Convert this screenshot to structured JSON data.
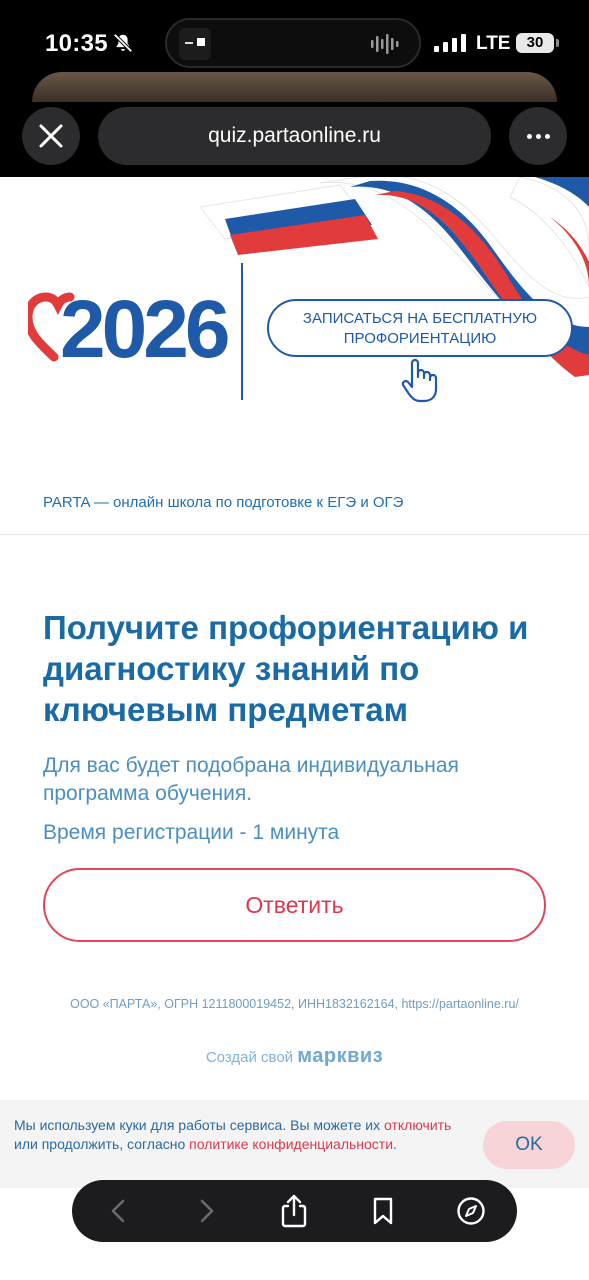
{
  "status_bar": {
    "time": "10:35",
    "network": "LTE",
    "battery": "30",
    "icons": [
      "bell-slash-icon",
      "signal-bars-icon",
      "audio-wave-icon"
    ]
  },
  "browser": {
    "url": "quiz.partaonline.ru",
    "close_icon": "close-icon",
    "more_icon": "ellipsis-icon"
  },
  "banner": {
    "year": "2026",
    "cta_line1": "ЗАПИСАТЬСЯ НА БЕСПЛАТНУЮ",
    "cta_line2": "ПРОФОРИЕНТАЦИЮ",
    "colors": {
      "blue": "#1e5aa8",
      "red": "#e23b3b",
      "white": "#ffffff"
    }
  },
  "school_line": "PARTA — онлайн школа по подготовке к ЕГЭ и ОГЭ",
  "main": {
    "headline": "Получите профориентацию и диагностику знаний по ключевым предметам",
    "sub1": "Для вас будет подобрана индивидуальная программа обучения.",
    "sub2": "Время регистрации - 1 минута",
    "answer_button": "Ответить"
  },
  "legal": "ООО «ПАРТА», ОГРН 1211800019452, ИНН1832162164, https://partaonline.ru/",
  "made_with": {
    "prefix": "Создай свой",
    "brand": "марквиз"
  },
  "cookie": {
    "part1": "Мы используем куки для работы сервиса. Вы можете их",
    "link1": "отключить",
    "part2": "или продолжить, согласно",
    "link2": "политике конфиденциальности",
    "end": ".",
    "ok": "OK"
  },
  "toolbar": {
    "icons": [
      "back-icon",
      "forward-icon",
      "share-icon",
      "bookmarks-icon",
      "compass-icon"
    ]
  }
}
